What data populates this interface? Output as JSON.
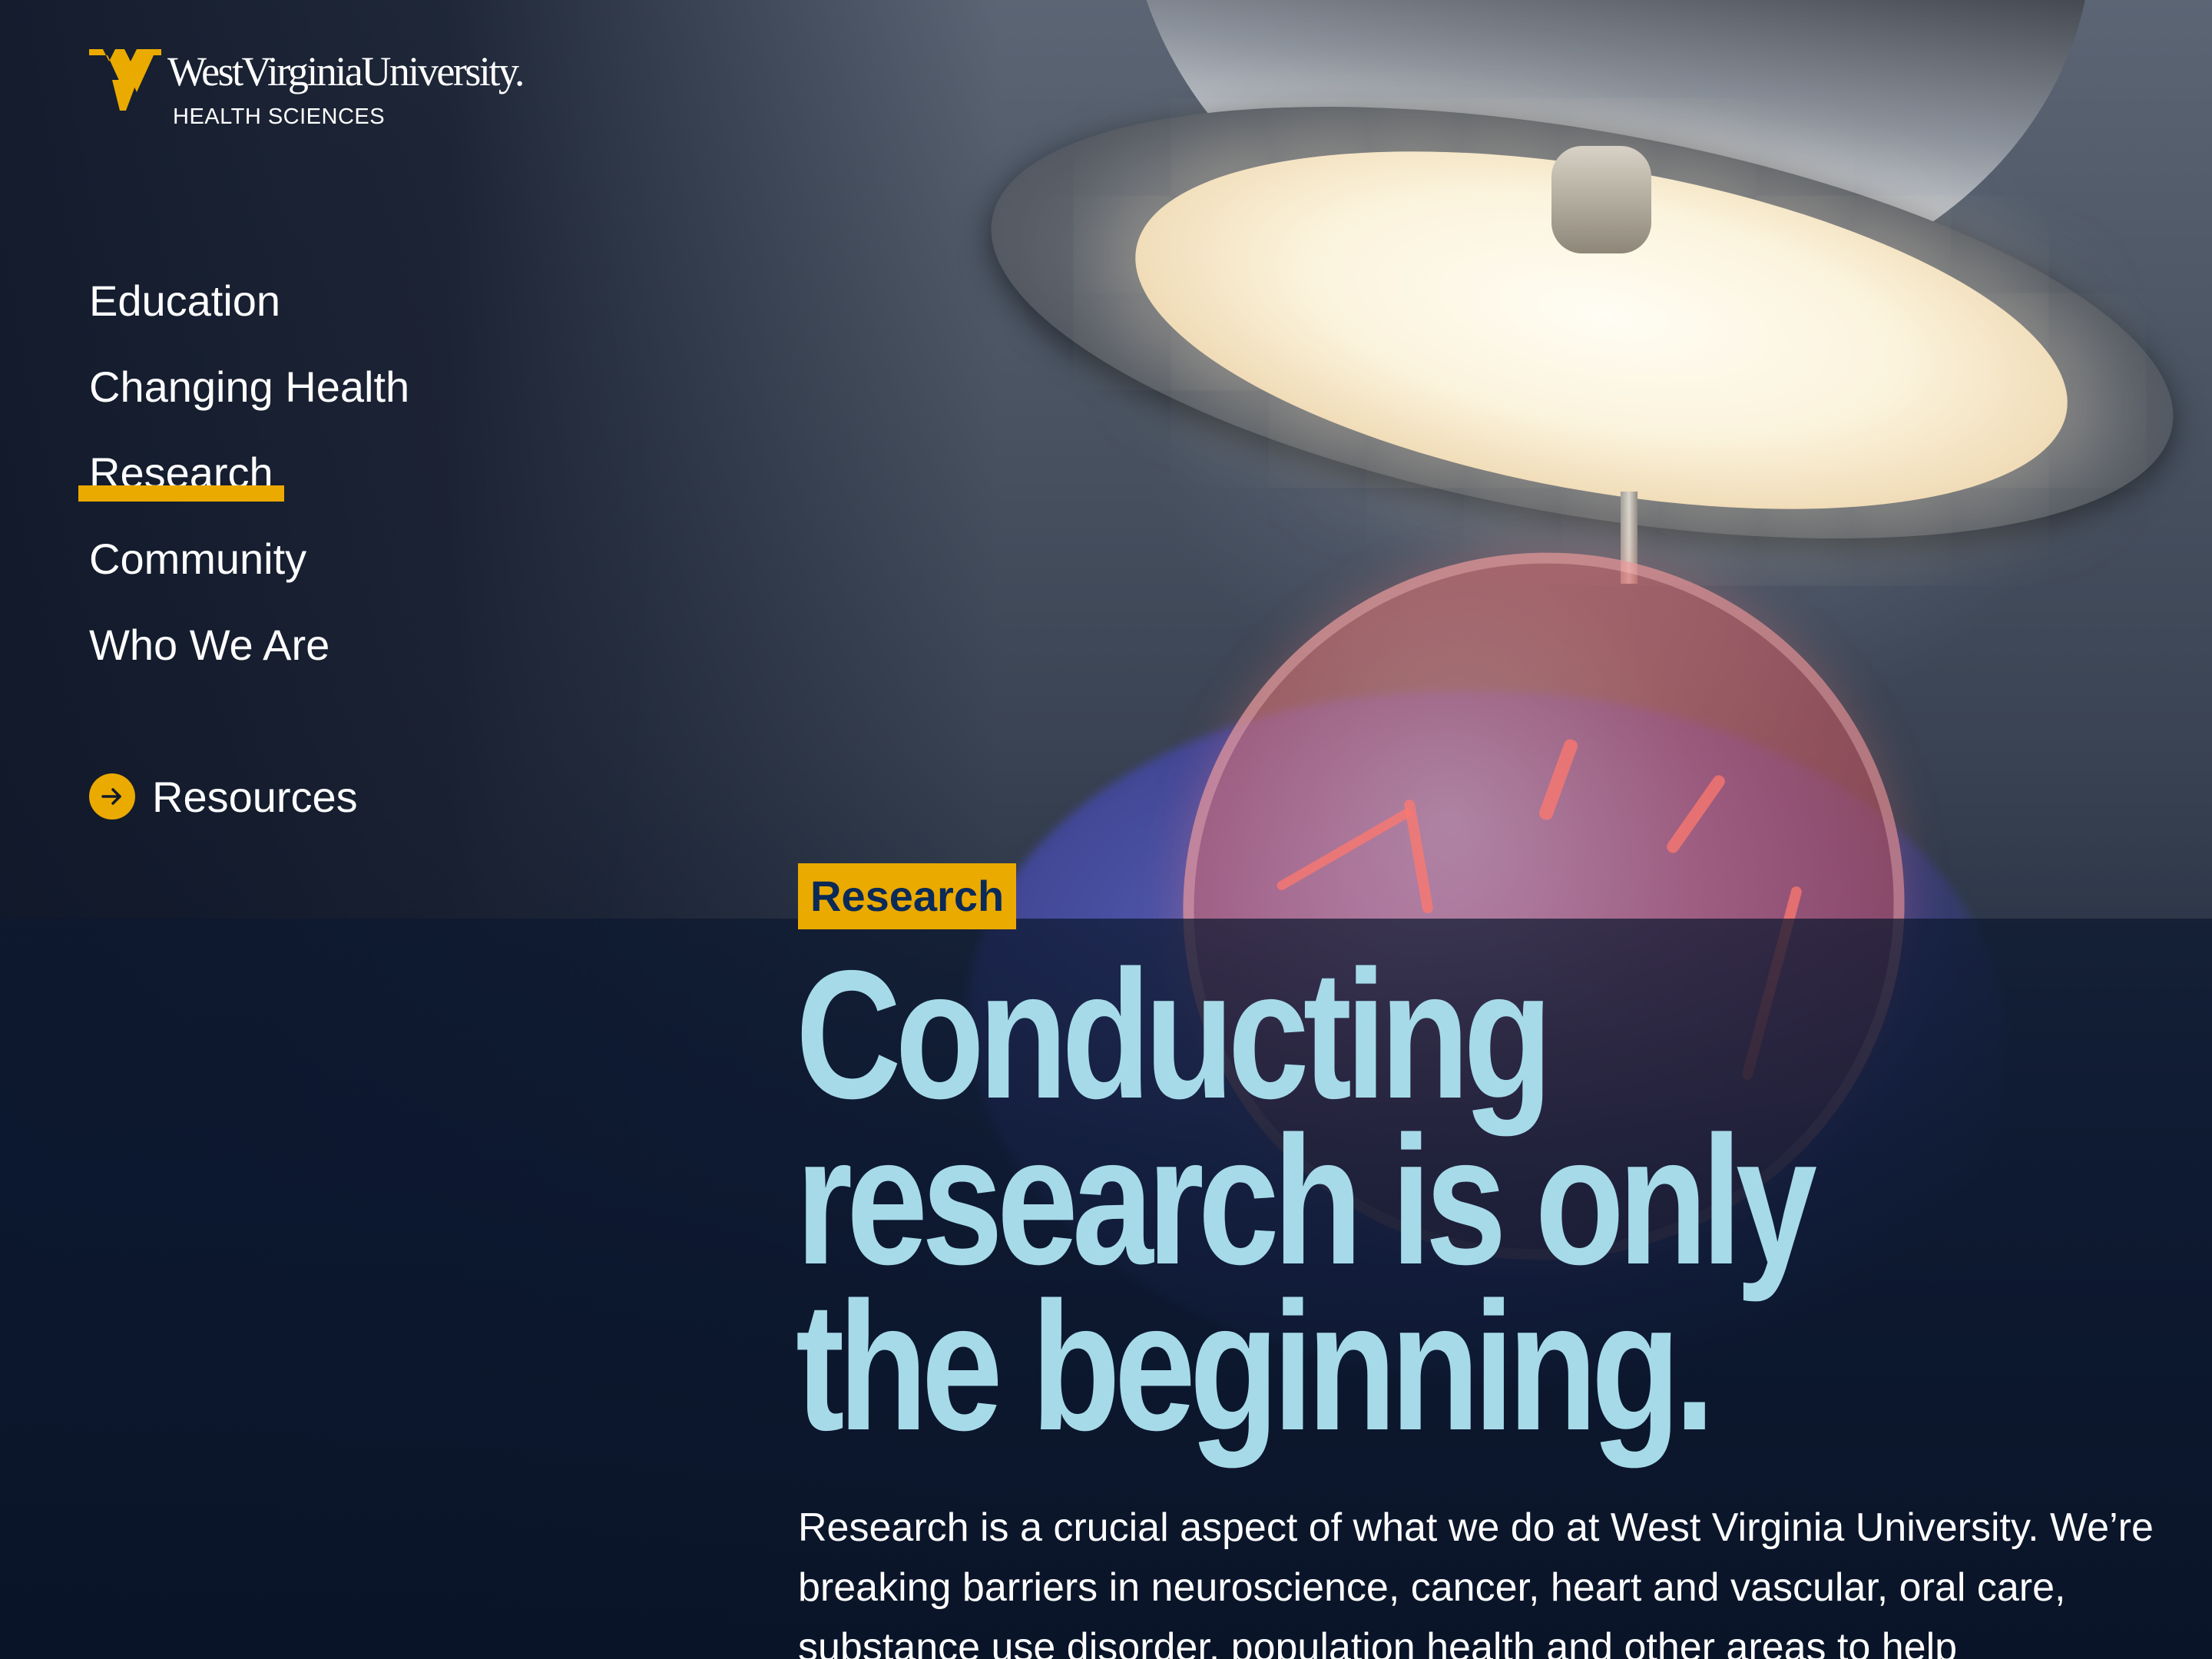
{
  "logo": {
    "name": "WestVirginiaUniversity.",
    "subtitle": "HEALTH SCIENCES",
    "brand_gold": "#eaaa00",
    "icon": "wv-logo-mark"
  },
  "nav": {
    "items": [
      {
        "label": "Education",
        "active": false
      },
      {
        "label": "Changing Health",
        "active": false
      },
      {
        "label": "Research",
        "active": true
      },
      {
        "label": "Community",
        "active": false
      },
      {
        "label": "Who We Are",
        "active": false
      }
    ],
    "resources": {
      "label": "Resources",
      "icon": "arrow-right-circle-icon"
    }
  },
  "hero": {
    "tag": "Research",
    "headline": [
      "Conducting",
      "research is only",
      "the beginning."
    ],
    "body": "Research is a crucial aspect of what we do at West Virginia University. We’re breaking barriers in neuroscience, cancer, heart and vascular, oral care, substance use disorder, population health and other areas to help"
  },
  "colors": {
    "gold": "#eaaa00",
    "navy": "#0b2a57",
    "headline": "#a6dae8",
    "text": "#ffffff"
  }
}
